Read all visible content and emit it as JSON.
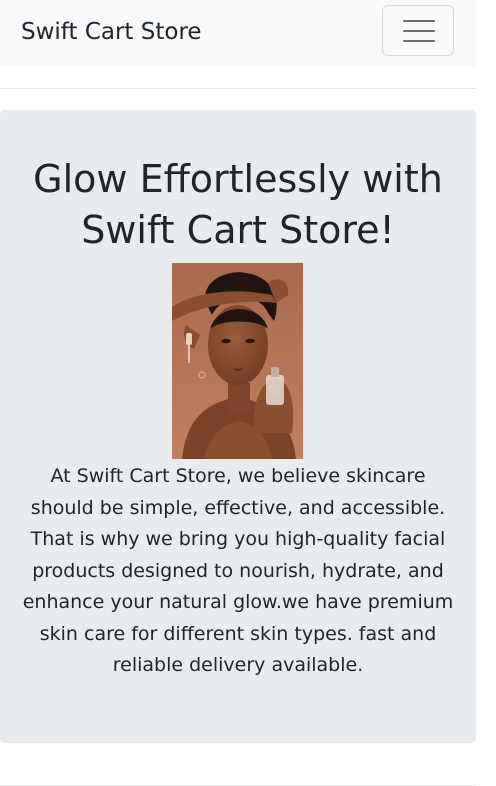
{
  "navbar": {
    "brand": "Swift Cart Store",
    "toggler_icon": "hamburger-menu-icon"
  },
  "hero": {
    "title": "Glow Effortlessly with Swift Cart Store!",
    "image_subject": "woman holding a skincare serum dropper bottle",
    "text": "At Swift Cart Store, we believe skincare should be simple, effective, and accessible. That is why we bring you high-quality facial products designed to nourish, hydrate, and enhance your natural glow.we have premium skin care for different skin types. fast and reliable delivery available."
  },
  "colors": {
    "navbar_bg": "#f8f9fa",
    "hero_bg": "#e9ecef",
    "text": "#212529",
    "toggler_border": "#d9dadb",
    "image_bg": "#b27554"
  }
}
